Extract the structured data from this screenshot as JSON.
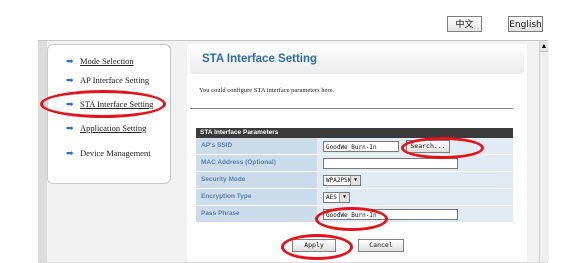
{
  "header": {
    "lang_chinese": "中文",
    "lang_english": "English"
  },
  "sidebar": {
    "items": [
      {
        "label": "Mode Selection"
      },
      {
        "label": "AP Interface Setting"
      },
      {
        "label": "STA Interface Setting"
      },
      {
        "label": "Application Setting"
      },
      {
        "label": "Device Management"
      }
    ]
  },
  "main": {
    "title": "STA Interface Setting",
    "description": "You could configure STA interface parameters here.",
    "section_title": "STA Interface Parameters",
    "fields": {
      "ssid": {
        "label": "AP's SSID",
        "value": "GoodWe_Burn-In",
        "search_button": "Search..."
      },
      "mac": {
        "label": "MAC Address (Optional)",
        "value": ""
      },
      "security": {
        "label": "Security Mode",
        "value": "WPA2PSK"
      },
      "encryption": {
        "label": "Encryption Type",
        "value": "AES"
      },
      "pass": {
        "label": "Pass Phrase",
        "value": "GoodWe_Burn-In"
      }
    },
    "apply_label": "Apply",
    "cancel_label": "Cancel"
  },
  "annotations": {
    "highlight_color": "#e4121b"
  }
}
